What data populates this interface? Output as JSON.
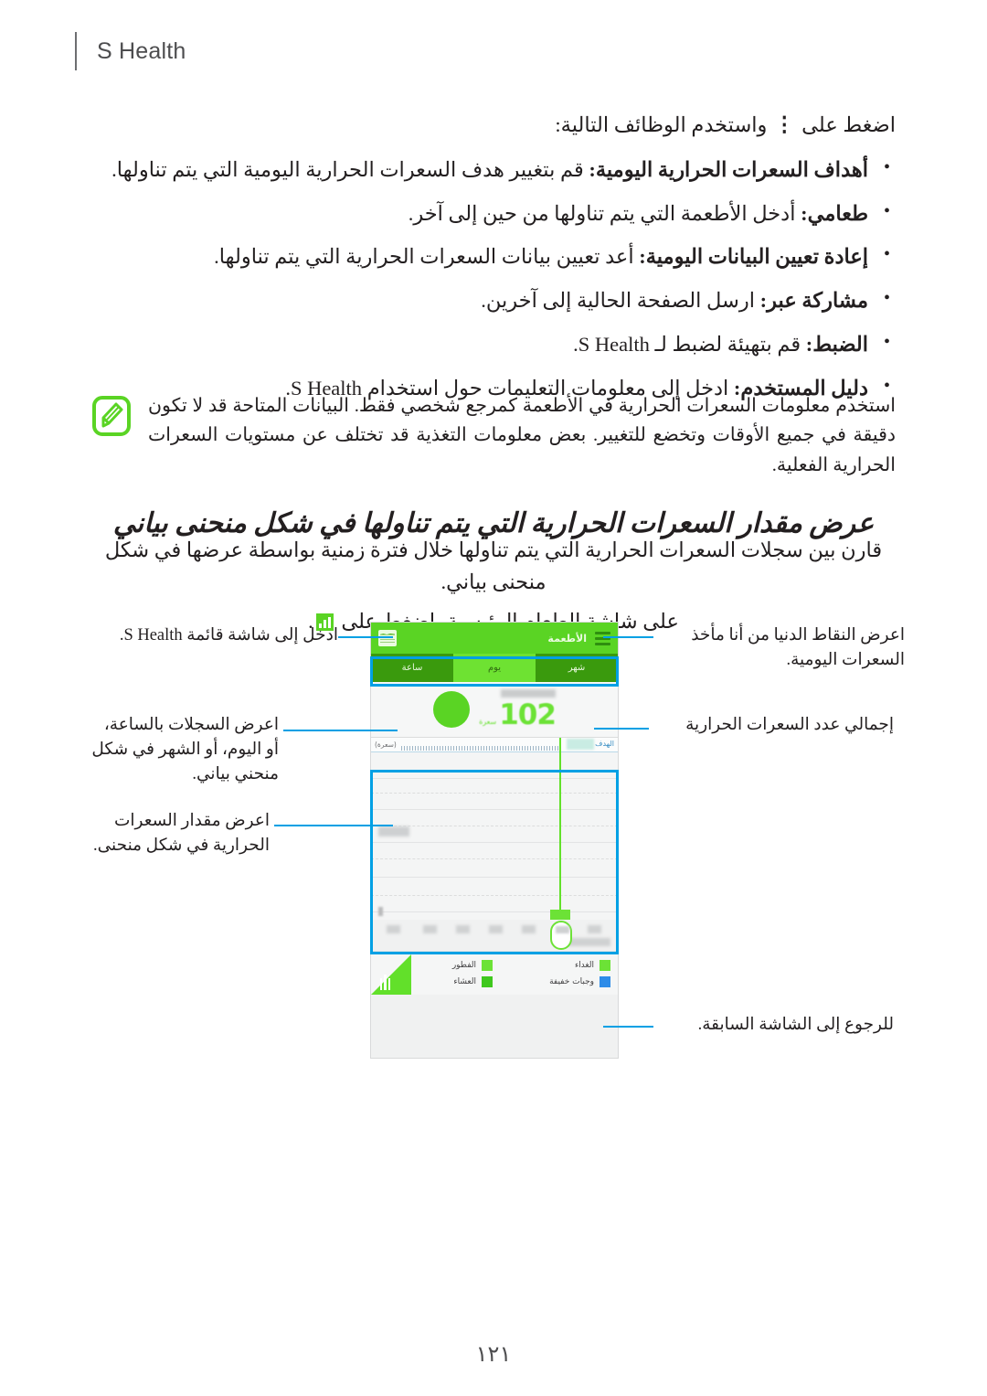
{
  "header": {
    "title": "S Health"
  },
  "intro": {
    "before_icon": "اضغط على",
    "icon": "kebab-menu-icon",
    "icon_glyph": "⋮",
    "after_icon": "واستخدم الوظائف التالية:"
  },
  "bullets": [
    {
      "term": "أهداف السعرات الحرارية اليومية:",
      "desc": "قم بتغيير هدف السعرات الحرارية اليومية التي يتم تناولها."
    },
    {
      "term": "طعامي:",
      "desc": "أدخل الأطعمة التي يتم تناولها من حين إلى آخر."
    },
    {
      "term": "إعادة تعيين البيانات اليومية:",
      "desc": "أعد تعيين بيانات السعرات الحرارية التي يتم تناولها."
    },
    {
      "term": "مشاركة عبر:",
      "desc": "ارسل الصفحة الحالية إلى آخرين."
    },
    {
      "term": "الضبط:",
      "desc": "قم بتهيئة لضبط لـ S Health."
    },
    {
      "term": "دليل المستخدم:",
      "desc": "ادخل إلى معلومات التعليمات حول استخدام S Health."
    }
  ],
  "note": {
    "icon": "note-pencil-icon",
    "text": "استخدم معلومات السعرات الحرارية في الأطعمة كمرجع شخصي فقط. البيانات المتاحة قد لا تكون دقيقة في جميع الأوقات وتخضع للتغيير. بعض معلومات التغذية قد تختلف عن مستويات السعرات الحرارية الفعلية.",
    "bold_term": "الأطعمة"
  },
  "section": {
    "heading": "عرض مقدار السعرات الحرارية التي يتم تناولها في شكل منحنى بياني",
    "paragraph": "قارن بين سجلات السعرات الحرارية التي يتم تناولها خلال فترة زمنية بواسطة عرضها في شكل منحنى بياني.",
    "instruction_before": "على شاشة الطعام الرئيسية، اضغط على",
    "instruction_icon": "bar-chart-icon",
    "instruction_after": "."
  },
  "phone": {
    "app_bar": {
      "menu_icon": "hamburger-menu-icon",
      "title": "الأطعمة",
      "chart_icon": "chart-view-icon"
    },
    "tabs": [
      {
        "label": "شهر",
        "active": false
      },
      {
        "label": "يوم",
        "active": true
      },
      {
        "label": "ساعة",
        "active": false
      }
    ],
    "summary": {
      "value": "102",
      "unit": "سعرة"
    },
    "graph": {
      "goal_label": "الهدف",
      "unit_label": "(سعرة)"
    },
    "legend": [
      {
        "label": "الغداء",
        "color": "#6ce236"
      },
      {
        "label": "الفطور",
        "color": "#6ce236"
      },
      {
        "label": "وجبات خفيفة",
        "color": "#2e8ce8"
      },
      {
        "label": "العشاء",
        "color": "#3fc81e"
      }
    ],
    "fab_icon": "cutlery-icon"
  },
  "annotations": {
    "menu": "ادخل إلى شاشة قائمة S Health.",
    "period": "اعرض السجلات بالساعة، أو اليوم، أو الشهر في شكل منحني بياني.",
    "graph": "اعرض مقدار السعرات الحرارية في شكل منحنى.",
    "points": "اعرض النقاط الدنيا من أنا مأخذ السعرات اليومية.",
    "total": "إجمالي عدد السعرات الحرارية",
    "back": "للرجوع إلى الشاشة السابقة."
  },
  "colors": {
    "brand_green": "#5ad424",
    "accent_blue": "#00a0e4",
    "tab_dark_green": "#3a9a0d",
    "tab_active_green": "#6ee232"
  },
  "page_number": "١٢١"
}
